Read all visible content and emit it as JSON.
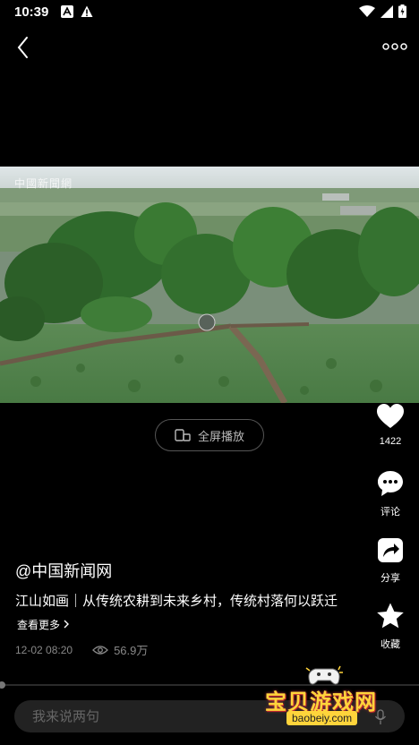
{
  "status_bar": {
    "time": "10:39"
  },
  "video": {
    "watermark": "中國新聞網"
  },
  "fullscreen": {
    "label": "全屏播放"
  },
  "actions": {
    "like_count": "1422",
    "comment_label": "评论",
    "share_label": "分享",
    "collect_label": "收藏"
  },
  "post": {
    "author": "@中国新闻网",
    "title": "江山如画｜从传统农耕到未来乡村，传统村落何以跃迁",
    "see_more": "查看更多",
    "date": "12-02 08:20",
    "views": "56.9万"
  },
  "comment": {
    "placeholder": "我来说两句"
  },
  "site_watermark": {
    "name": "宝贝游戏网",
    "url": "baobeiy.com"
  },
  "colors": {
    "background": "#000000",
    "accent_yellow": "#ffd43b",
    "muted_text": "#888888"
  }
}
